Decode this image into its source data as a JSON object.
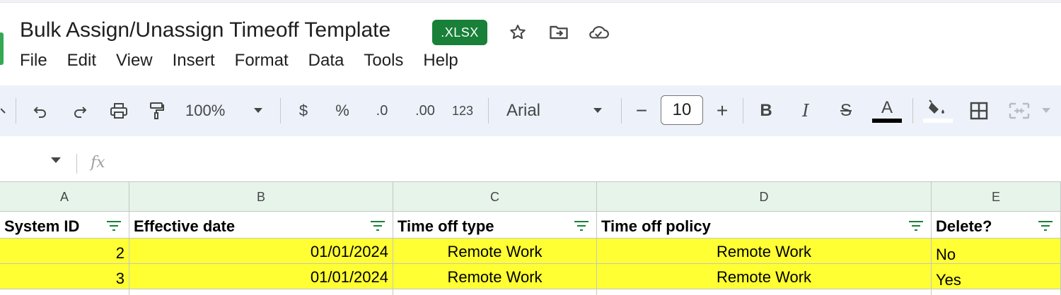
{
  "document": {
    "title": "Bulk Assign/Unassign Timeoff Template",
    "extension_badge": ".XLSX"
  },
  "title_icons": [
    "star-icon",
    "move-to-folder-icon",
    "cloud-saved-icon"
  ],
  "menu": [
    "File",
    "Edit",
    "View",
    "Insert",
    "Format",
    "Data",
    "Tools",
    "Help"
  ],
  "toolbar": {
    "zoom": "100%",
    "currency": "$",
    "percent": "%",
    "decrease_decimal": ".0",
    "increase_decimal": ".00",
    "number_format": "123",
    "font": "Arial",
    "font_size": "10",
    "minus": "−",
    "plus": "+",
    "bold": "B",
    "italic": "I",
    "strikethrough": "S",
    "text_color": "A",
    "text_color_hex": "#000000",
    "fill_color_hex": "#ffffff"
  },
  "formula_bar": {
    "fx": "fx"
  },
  "sheet": {
    "columns": [
      "A",
      "B",
      "C",
      "D",
      "E"
    ],
    "headers": [
      "System ID",
      "Effective date",
      "Time off type",
      "Time off policy",
      "Delete?"
    ],
    "rows": [
      [
        "2",
        "01/01/2024",
        "Remote Work",
        "Remote Work",
        "No"
      ],
      [
        "3",
        "01/01/2024",
        "Remote Work",
        "Remote Work",
        "Yes"
      ]
    ],
    "highlight_color": "#ffff33",
    "header_band_color": "#e6f4ea",
    "filter_color": "#188038"
  }
}
